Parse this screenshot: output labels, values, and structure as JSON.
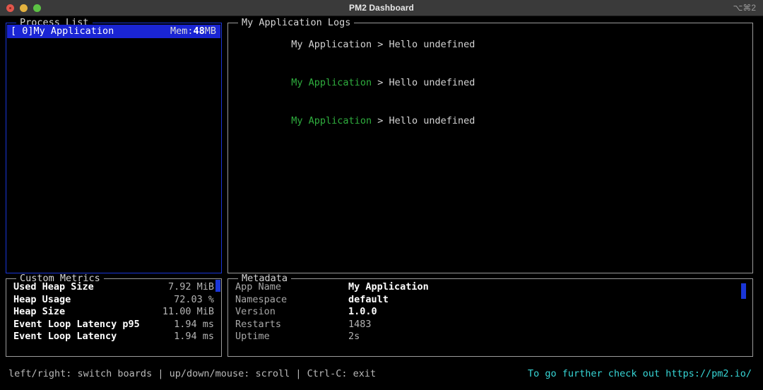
{
  "window": {
    "title": "PM2 Dashboard",
    "shortcut": "⌥⌘2",
    "traffic_lights": [
      "close-button",
      "minimize-button",
      "zoom-button"
    ]
  },
  "colors": {
    "focus_border": "#1a36d8",
    "panel_border": "#9b9b9b",
    "selection": "#1a25d4",
    "log_green": "#2fae3e",
    "link_cyan": "#37d6d6",
    "scrollbar": "#1a36d8",
    "background": "#000000",
    "titlebar": "#3a3a3a"
  },
  "process_panel": {
    "title": "Process List",
    "focused": true,
    "rows": [
      {
        "id": "[ 0]",
        "name": "My Application",
        "mem_label": "Mem:",
        "mem_value": "48",
        "mem_unit": "MB",
        "selected": true
      }
    ]
  },
  "logs_panel": {
    "title": "My Application Logs",
    "lines": [
      {
        "app": "My Application",
        "app_color": "white",
        "arrow": " > ",
        "message": "Hello undefined"
      },
      {
        "app": "My Application",
        "app_color": "green",
        "arrow": " > ",
        "message": "Hello undefined"
      },
      {
        "app": "My Application",
        "app_color": "green",
        "arrow": " > ",
        "message": "Hello undefined"
      }
    ]
  },
  "metrics_panel": {
    "title": "Custom Metrics",
    "rows": [
      {
        "key": "Used Heap Size",
        "value": "7.92 MiB"
      },
      {
        "key": "Heap Usage",
        "value": "72.03 %"
      },
      {
        "key": "Heap Size",
        "value": "11.00 MiB"
      },
      {
        "key": "Event Loop Latency p95",
        "value": "1.94 ms"
      },
      {
        "key": "Event Loop Latency",
        "value": "1.94 ms"
      }
    ]
  },
  "metadata_panel": {
    "title": "Metadata",
    "rows": [
      {
        "key": "App Name",
        "value": "My Application",
        "strong": true
      },
      {
        "key": "Namespace",
        "value": "default",
        "strong": true
      },
      {
        "key": "Version",
        "value": "1.0.0",
        "strong": true
      },
      {
        "key": "Restarts",
        "value": "1483",
        "strong": false
      },
      {
        "key": "Uptime",
        "value": "2s",
        "strong": false
      }
    ]
  },
  "statusbar": {
    "help": "left/right: switch boards | up/down/mouse: scroll | Ctrl-C: exit",
    "promo": "To go further check out https://pm2.io/"
  }
}
